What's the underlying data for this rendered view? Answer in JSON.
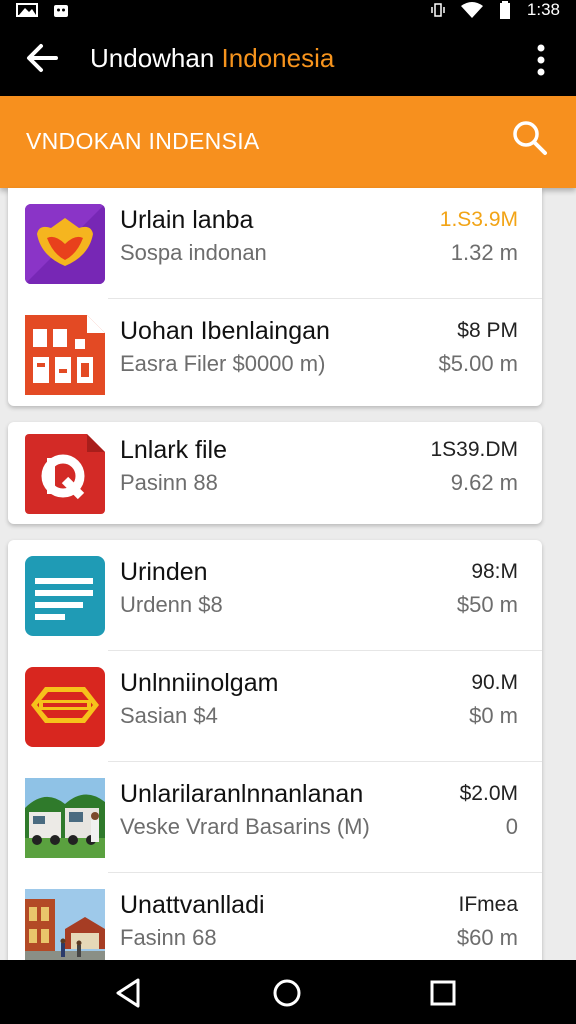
{
  "status_bar": {
    "time": "1:38",
    "icons": [
      "gallery-icon",
      "android-icon",
      "vibrate-icon",
      "wifi-icon",
      "battery-icon"
    ]
  },
  "app_bar": {
    "title_part1": "Undowhan ",
    "title_part2": "Indonesia",
    "accent_color": "#f7941d",
    "icons": [
      "back-arrow-icon",
      "more-vert-icon"
    ]
  },
  "search_bar": {
    "title": "VNDOKAN INDENSIA",
    "background": "#f7901e",
    "icon": "search-icon"
  },
  "cards": [
    {
      "items": [
        {
          "name": "Urlain lanba",
          "subtitle": "Sospa indonan",
          "size": "1.S3.9M",
          "meta": "1.32 m",
          "icon": "purple-shield-app-icon",
          "size_highlight": true
        },
        {
          "name": "Uohan Ibenlaingan",
          "subtitle": "Easra Filer $0000 m)",
          "size": "$8 PM",
          "meta": "$5.00 m",
          "icon": "red-document-app-icon"
        }
      ]
    },
    {
      "items": [
        {
          "name": "Lnlark file",
          "subtitle": "Pasinn 88",
          "size": "1S39.DM",
          "meta": "9.62 m",
          "icon": "red-r-file-app-icon"
        }
      ]
    },
    {
      "items": [
        {
          "name": "Urinden",
          "subtitle": "Urdenn $8",
          "size": "98:M",
          "meta": "$50 m",
          "icon": "teal-notes-app-icon"
        },
        {
          "name": "Unlnniinolgam",
          "subtitle": "Sasian $4",
          "size": "90.M",
          "meta": "$0 m",
          "icon": "red-yellow-banner-app-icon"
        },
        {
          "name": "Unlarilaranlnnanlanan",
          "subtitle": "Veske Vrard Basarins (M)",
          "size": "$2.0M",
          "meta": "0",
          "icon": "photo-trucks-thumbnail"
        },
        {
          "name": "Unattvanlladi",
          "subtitle": "Fasinn 68",
          "size": "IFmea",
          "meta": "$60 m",
          "icon": "photo-building-thumbnail"
        }
      ]
    }
  ],
  "nav_bar": {
    "icons": [
      "back-triangle-icon",
      "home-circle-icon",
      "recents-square-icon"
    ]
  }
}
